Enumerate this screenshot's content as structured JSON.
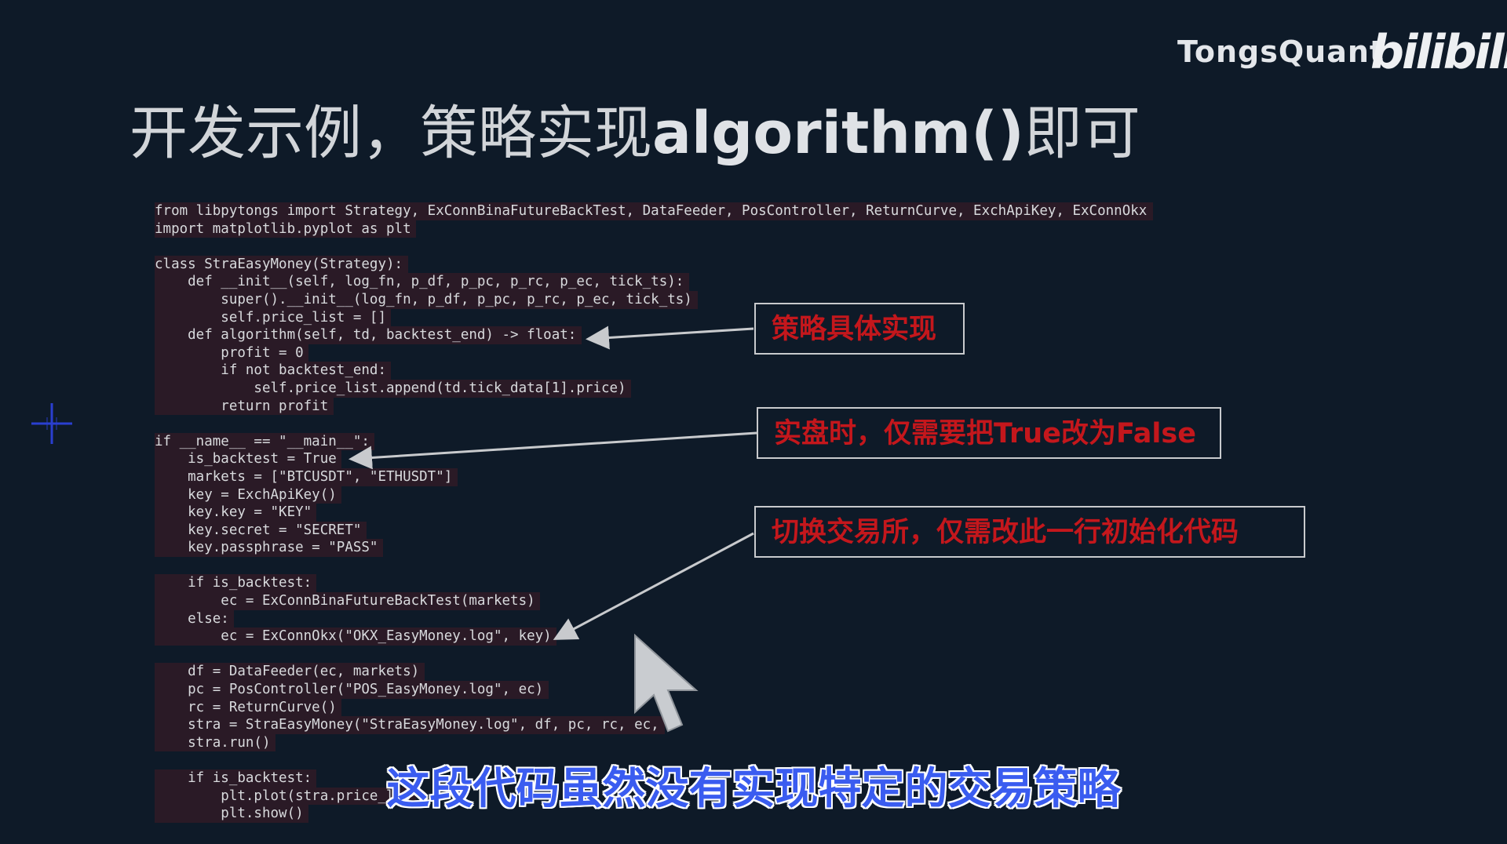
{
  "brand": {
    "name": "TongsQuant",
    "logo": "bilibili"
  },
  "slide": {
    "title_prefix": "开发示例，策略实现",
    "title_code": "algorithm()",
    "title_suffix": "即可"
  },
  "code": {
    "lines": [
      "from libpytongs import Strategy, ExConnBinaFutureBackTest, DataFeeder, PosController, ReturnCurve, ExchApiKey, ExConnOkx",
      "import matplotlib.pyplot as plt",
      "",
      "class StraEasyMoney(Strategy):",
      "    def __init__(self, log_fn, p_df, p_pc, p_rc, p_ec, tick_ts):",
      "        super().__init__(log_fn, p_df, p_pc, p_rc, p_ec, tick_ts)",
      "        self.price_list = []",
      "    def algorithm(self, td, backtest_end) -> float:",
      "        profit = 0",
      "        if not backtest_end:",
      "            self.price_list.append(td.tick_data[1].price)",
      "        return profit",
      "",
      "if __name__ == \"__main__\":",
      "    is_backtest = True",
      "    markets = [\"BTCUSDT\", \"ETHUSDT\"]",
      "    key = ExchApiKey()",
      "    key.key = \"KEY\"",
      "    key.secret = \"SECRET\"",
      "    key.passphrase = \"PASS\"",
      "",
      "    if is_backtest:",
      "        ec = ExConnBinaFutureBackTest(markets)",
      "    else:",
      "        ec = ExConnOkx(\"OKX_EasyMoney.log\", key)",
      "",
      "    df = DataFeeder(ec, markets)",
      "    pc = PosController(\"POS_EasyMoney.log\", ec)",
      "    rc = ReturnCurve()",
      "    stra = StraEasyMoney(\"StraEasyMoney.log\", df, pc, rc, ec,",
      "    stra.run()",
      "",
      "    if is_backtest:",
      "        plt.plot(stra.price_lis",
      "        plt.show()"
    ]
  },
  "callouts": {
    "strategy": "策略具体实现",
    "live": "实盘时，仅需要把True改为False",
    "exchange": "切换交易所，仅需改此一行初始化代码"
  },
  "subtitle": "这段代码虽然没有实现特定的交易策略",
  "colors": {
    "background": "#0e1a28",
    "callout_text": "#c4171c",
    "subtitle": "#3a5cf0",
    "code_highlight": "#2a1a26"
  },
  "icons": {
    "crosshair": "crosshair-icon",
    "cursor": "mouse-pointer-icon"
  }
}
